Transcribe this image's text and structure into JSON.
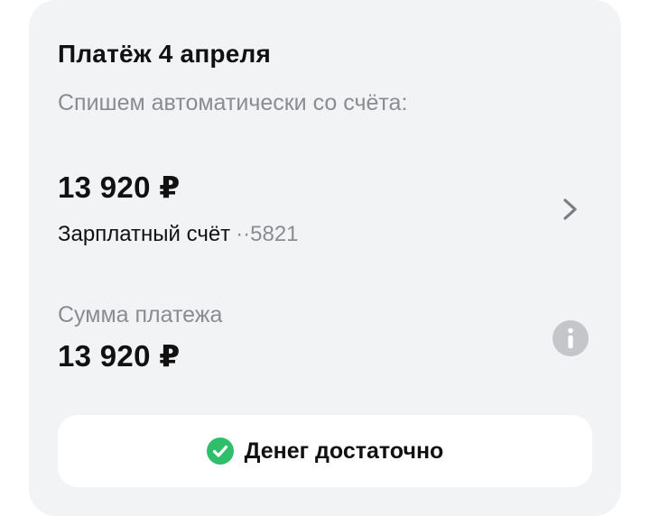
{
  "payment": {
    "title": "Платёж 4 апреля",
    "subtitle": "Спишем автоматически со счёта:"
  },
  "account": {
    "amount": "13 920 ₽",
    "name": "Зарплатный счёт",
    "mask": "··5821",
    "chevron_icon": "chevron-right-icon"
  },
  "sum": {
    "label": "Сумма платежа",
    "value": "13 920 ₽",
    "info_icon": "info-icon"
  },
  "status": {
    "text": "Денег достаточно",
    "icon": "check-circle-icon",
    "icon_color": "#2fbf6b"
  },
  "colors": {
    "card_bg": "#f2f3f5",
    "secondary_text": "#8a8c91",
    "primary_text": "#111111",
    "info_icon_bg": "#c4c6ca"
  }
}
